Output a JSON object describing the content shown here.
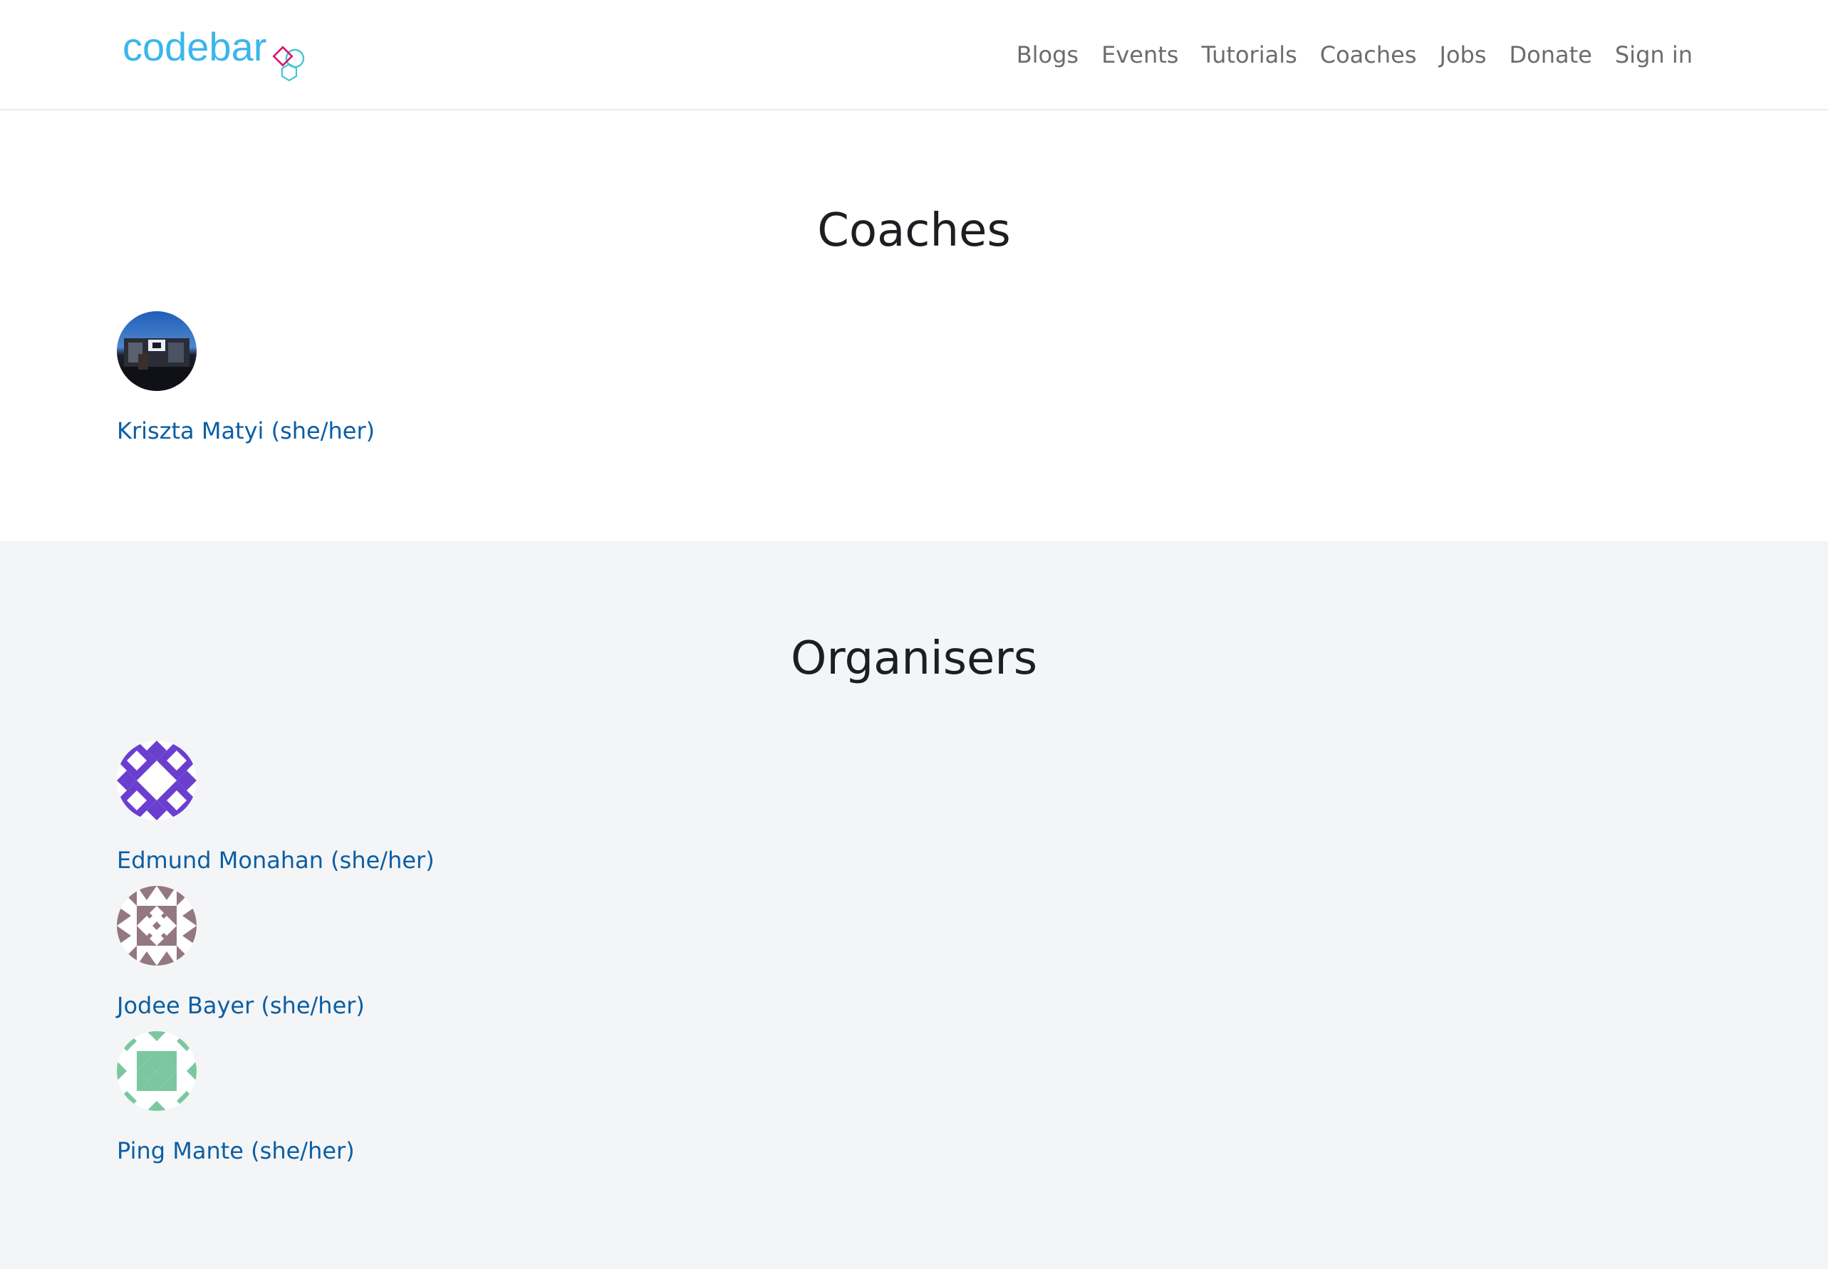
{
  "header": {
    "logo_text": "codebar",
    "nav": [
      {
        "label": "Blogs"
      },
      {
        "label": "Events"
      },
      {
        "label": "Tutorials"
      },
      {
        "label": "Coaches"
      },
      {
        "label": "Jobs"
      },
      {
        "label": "Donate"
      },
      {
        "label": "Sign in"
      }
    ]
  },
  "coaches": {
    "title": "Coaches",
    "members": [
      {
        "name": "Kriszta Matyi (she/her)",
        "avatar": "photo"
      }
    ]
  },
  "organisers": {
    "title": "Organisers",
    "members": [
      {
        "name": "Edmund Monahan (she/her)",
        "avatar": "identicon",
        "color": "#6a3fd0"
      },
      {
        "name": "Jodee Bayer (she/her)",
        "avatar": "identicon",
        "color": "#94787f"
      },
      {
        "name": "Ping Mante (she/her)",
        "avatar": "identicon",
        "color": "#7bc7a0"
      }
    ]
  },
  "colors": {
    "link": "#0b5ea3",
    "nav_text": "#6c6c6c",
    "logo": "#3cb6ea",
    "organisers_bg": "#f4f5f7"
  }
}
